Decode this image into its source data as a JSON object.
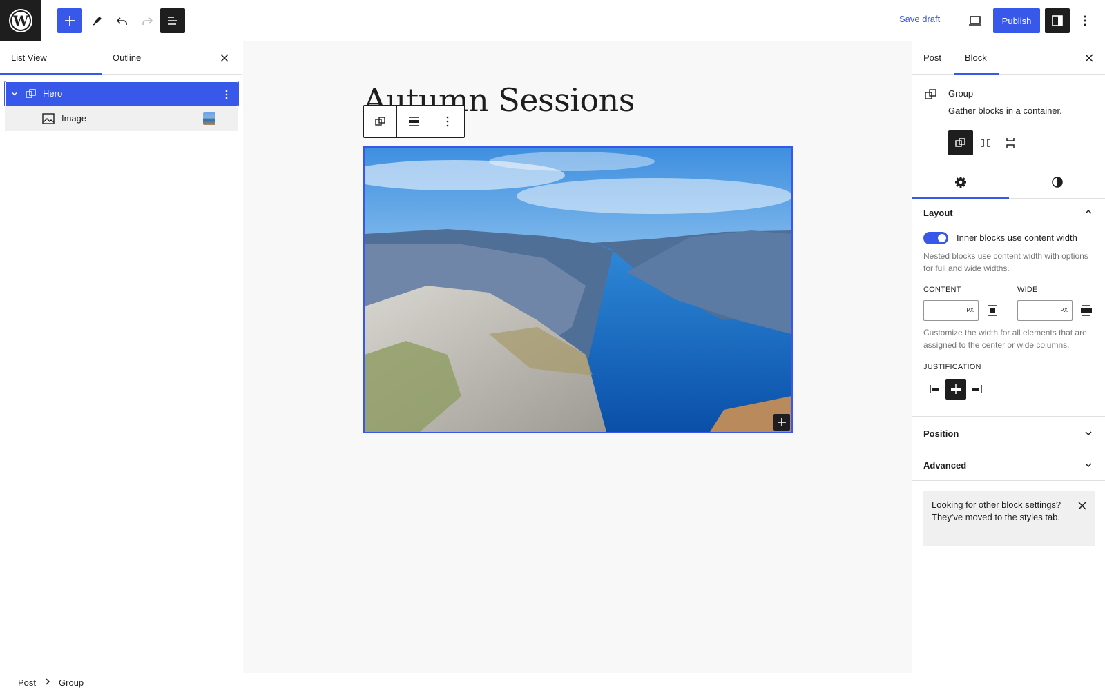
{
  "topbar": {
    "logo_icon": "wordpress-logo-icon",
    "add_icon": "plus-icon",
    "tools_icon": "pencil-icon",
    "undo_icon": "undo-icon",
    "redo_icon": "redo-icon",
    "listview_icon": "list-view-icon",
    "save_draft_label": "Save draft",
    "preview_icon": "desktop-icon",
    "publish_label": "Publish",
    "settings_icon": "sidebar-icon",
    "options_icon": "more-vertical-icon"
  },
  "left_panel": {
    "tabs": [
      {
        "label": "List View"
      },
      {
        "label": "Outline"
      }
    ],
    "active_tab": "List View",
    "items": [
      {
        "label": "Hero",
        "icon": "group-icon",
        "selected": true,
        "expanded": true
      },
      {
        "label": "Image",
        "icon": "image-icon",
        "selected": false
      }
    ]
  },
  "canvas": {
    "post_title": "Autumn Sessions",
    "block_toolbar": [
      "group-icon",
      "align-icon",
      "more-vertical-icon"
    ]
  },
  "right_panel": {
    "tabs": [
      {
        "label": "Post"
      },
      {
        "label": "Block"
      }
    ],
    "active_tab": "Block",
    "block_card": {
      "name": "Group",
      "description": "Gather blocks in a container."
    },
    "layout": {
      "title": "Layout",
      "toggle_label": "Inner blocks use content width",
      "toggle_on": true,
      "toggle_help": "Nested blocks use content width with options for full and wide widths.",
      "content_label": "CONTENT",
      "content_value": "",
      "wide_label": "WIDE",
      "wide_value": "",
      "unit": "PX",
      "width_help": "Customize the width for all elements that are assigned to the center or wide columns.",
      "justification_label": "JUSTIFICATION",
      "justification_selected": "center"
    },
    "position_title": "Position",
    "advanced_title": "Advanced",
    "notice": "Looking for other block settings? They've moved to the styles tab."
  },
  "footer": {
    "breadcrumbs": [
      {
        "label": "Post"
      },
      {
        "label": "Group"
      }
    ]
  },
  "colors": {
    "accent": "#3858e9",
    "dark": "#1e1e1e"
  }
}
